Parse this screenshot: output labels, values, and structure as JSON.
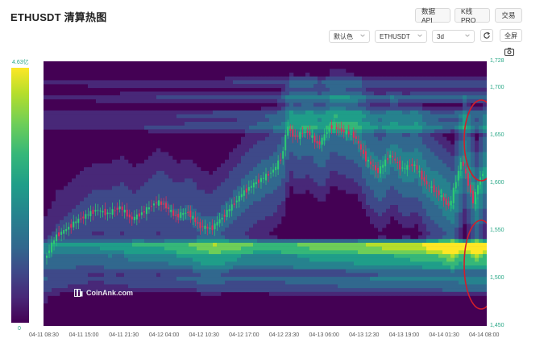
{
  "header": {
    "title": "ETHUSDT 清算热图",
    "buttons": {
      "data_api": "数据API",
      "kline_pro": "K线 PRO",
      "trade": "交易"
    }
  },
  "toolbar": {
    "color_scheme": "默认色",
    "pair": "ETHUSDT",
    "range": "3d",
    "fullscreen": "全屏",
    "icons": [
      "refresh-icon",
      "camera-icon",
      "chevron-down-icon"
    ]
  },
  "colorbar": {
    "max_label": "4.63亿",
    "min_label": "0"
  },
  "watermark": {
    "text": "CoinAnk.com"
  },
  "chart_data": {
    "type": "heatmap",
    "title": "ETHUSDT 清算热图",
    "colorscale": [
      "#440154",
      "#482878",
      "#3e4989",
      "#31688e",
      "#26828e",
      "#1f9e89",
      "#35b779",
      "#6ece58",
      "#b5de2b",
      "#fde725"
    ],
    "color_range": [
      0,
      "4.63亿"
    ],
    "ylim": [
      1450,
      1728
    ],
    "y_ticks": [
      "1,728",
      "1,700",
      "1,650",
      "1,600",
      "1,550",
      "1,500",
      "1,450"
    ],
    "y_tick_values": [
      1728,
      1700,
      1650,
      1600,
      1550,
      1500,
      1450
    ],
    "x_ticks": [
      "04-11 08:30",
      "04-11 15:00",
      "04-11 21:30",
      "04-12 04:00",
      "04-12 10:30",
      "04-12 17:00",
      "04-12 23:30",
      "04-13 06:00",
      "04-13 12:30",
      "04-13 19:00",
      "04-14 01:30",
      "04-14 08:00"
    ],
    "price_series": {
      "type": "candlestick",
      "x_index": [
        0,
        0.3,
        0.5,
        0.8,
        1.0,
        1.3,
        1.6,
        1.9,
        2.2,
        2.5,
        2.8,
        3.0,
        3.3,
        3.6,
        3.9,
        4.2,
        4.5,
        4.7,
        5.0,
        5.3,
        5.6,
        5.8,
        6.0,
        6.1,
        6.3,
        6.6,
        6.9,
        7.2,
        7.5,
        7.8,
        8.1,
        8.4,
        8.7,
        9.0,
        9.3,
        9.6,
        9.9,
        10.2,
        10.5,
        10.8,
        11.0
      ],
      "close": [
        1520,
        1545,
        1550,
        1560,
        1565,
        1572,
        1568,
        1575,
        1562,
        1570,
        1580,
        1578,
        1565,
        1570,
        1555,
        1552,
        1565,
        1575,
        1590,
        1600,
        1608,
        1615,
        1630,
        1660,
        1648,
        1655,
        1640,
        1660,
        1655,
        1650,
        1625,
        1612,
        1630,
        1615,
        1620,
        1600,
        1590,
        1575,
        1625,
        1580,
        1610
      ]
    },
    "heat_bands": [
      {
        "price": 1535,
        "intensity": 0.95
      },
      {
        "price": 1528,
        "intensity": 0.7
      },
      {
        "price": 1520,
        "intensity": 0.6
      },
      {
        "price": 1512,
        "intensity": 0.55
      },
      {
        "price": 1500,
        "intensity": 0.5
      },
      {
        "price": 1490,
        "intensity": 0.4
      },
      {
        "price": 1660,
        "intensity": 0.55
      },
      {
        "price": 1672,
        "intensity": 0.5
      },
      {
        "price": 1690,
        "intensity": 0.45
      },
      {
        "price": 1705,
        "intensity": 0.4
      }
    ]
  }
}
